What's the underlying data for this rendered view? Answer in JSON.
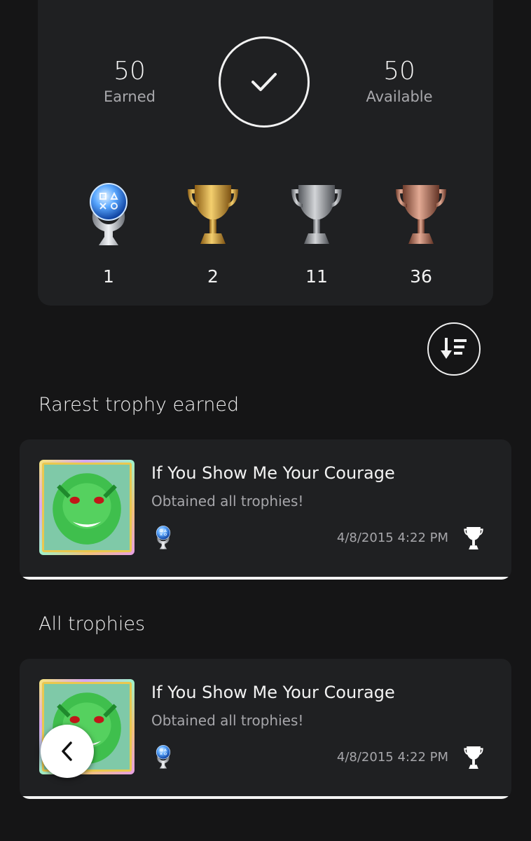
{
  "summary": {
    "earned": {
      "value": "50",
      "label": "Earned"
    },
    "available": {
      "value": "50",
      "label": "Available"
    },
    "grades": [
      {
        "name": "platinum",
        "count": "1"
      },
      {
        "name": "gold",
        "count": "2"
      },
      {
        "name": "silver",
        "count": "11"
      },
      {
        "name": "bronze",
        "count": "36"
      }
    ]
  },
  "sections": {
    "rarest_title": "Rarest trophy earned",
    "all_title": "All trophies"
  },
  "rarest_trophy": {
    "title": "If You Show Me Your Courage",
    "description": "Obtained all trophies!",
    "date": "4/8/2015",
    "time": "4:22 PM",
    "grade": "platinum"
  },
  "all_trophies": [
    {
      "title": "If You Show Me Your Courage",
      "description": "Obtained all trophies!",
      "date": "4/8/2015",
      "time": "4:22 PM",
      "grade": "platinum"
    }
  ],
  "icons": {
    "completed": "check-icon",
    "sort": "sort-icon",
    "back": "chevron-left-icon",
    "trophy": "trophy-icon"
  },
  "colors": {
    "background": "#151516",
    "card": "#1f2022",
    "platinum": "#6fb7ff",
    "gold": "#d9a53c",
    "silver": "#a9abae",
    "bronze": "#b97865"
  }
}
